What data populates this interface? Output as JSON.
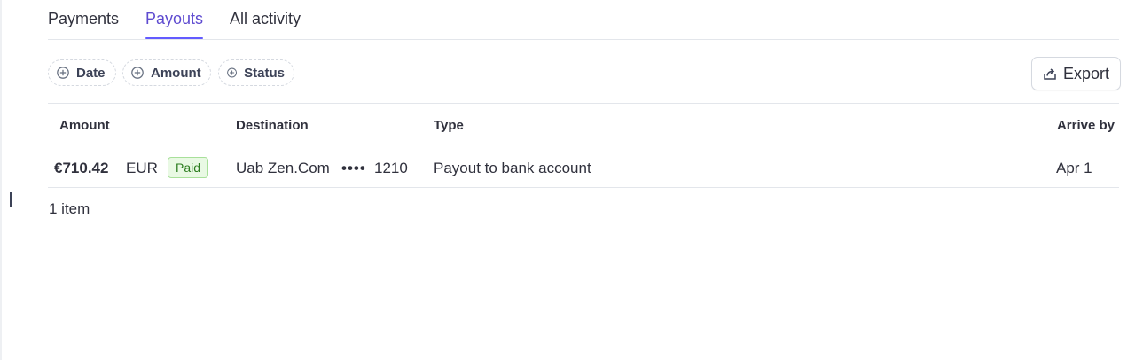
{
  "tabs": [
    {
      "label": "Payments",
      "active": false
    },
    {
      "label": "Payouts",
      "active": true
    },
    {
      "label": "All activity",
      "active": false
    }
  ],
  "filters": {
    "date": "Date",
    "amount": "Amount",
    "status": "Status"
  },
  "export_label": "Export",
  "table": {
    "headers": {
      "amount": "Amount",
      "destination": "Destination",
      "type": "Type",
      "arrive_by": "Arrive by"
    },
    "rows": [
      {
        "amount": "€710.42",
        "currency": "EUR",
        "status": "Paid",
        "destination_name": "Uab Zen.Com",
        "destination_mask": "••••",
        "destination_last4": "1210",
        "type": "Payout to bank account",
        "arrive_by": "Apr 1"
      }
    ]
  },
  "item_count": "1 item",
  "colors": {
    "accent": "#635bff",
    "active_tab_text": "#5e4bd0",
    "paid_badge_bg": "#e9f9e4",
    "paid_badge_border": "#a8e09a",
    "paid_badge_text": "#2c7d1f"
  },
  "icons": {
    "filter_add": "plus-circle-icon",
    "export": "export-icon"
  }
}
